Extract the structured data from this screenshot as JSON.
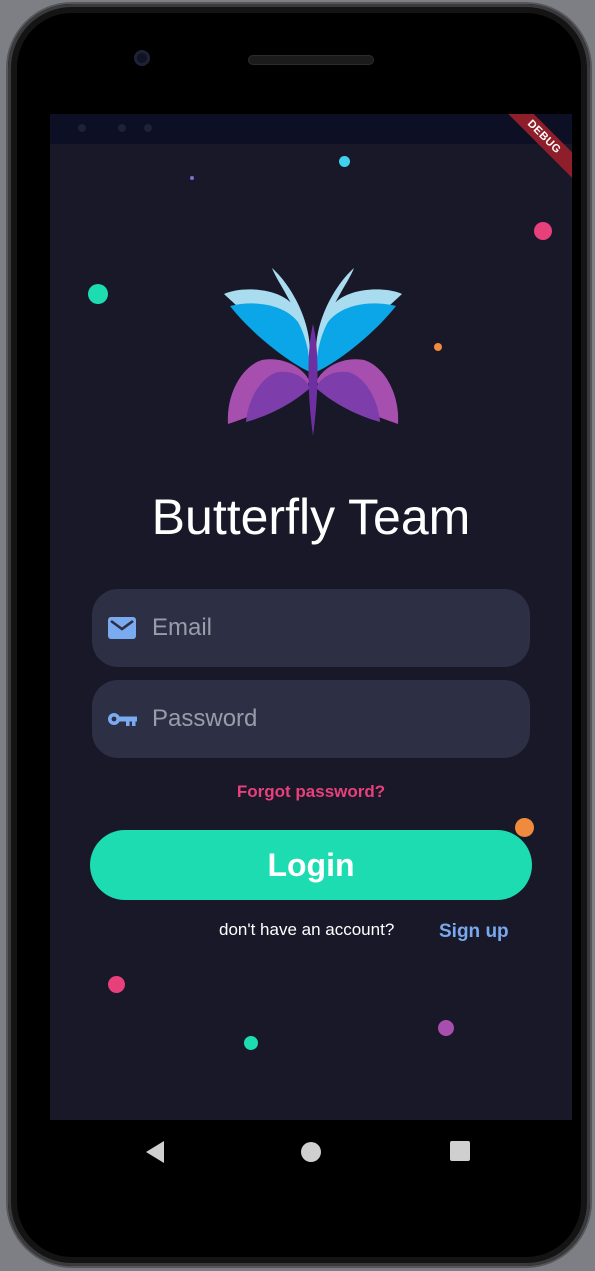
{
  "app": {
    "title": "Butterfly Team",
    "debug_banner": "DEBUG"
  },
  "form": {
    "email": {
      "placeholder": "Email",
      "value": "",
      "icon": "mail-icon"
    },
    "password": {
      "placeholder": "Password",
      "value": "",
      "icon": "key-icon"
    },
    "forgot_label": "Forgot password?",
    "login_label": "Login",
    "no_account_text": "don't have an account?",
    "signup_label": "Sign up"
  },
  "navigation": {
    "back_icon": "back-triangle-icon",
    "home_icon": "home-circle-icon",
    "recents_icon": "recents-square-icon"
  },
  "colors": {
    "background": "#181828",
    "field_bg": "#2d2f44",
    "accent_teal": "#1ddcb2",
    "accent_pink": "#e8407b",
    "link_blue": "#79a8ee",
    "butterfly_blue": "#0aa6e8",
    "butterfly_light": "#a9dcef",
    "butterfly_purple": "#7d3dab",
    "butterfly_violet": "#a74fae"
  }
}
